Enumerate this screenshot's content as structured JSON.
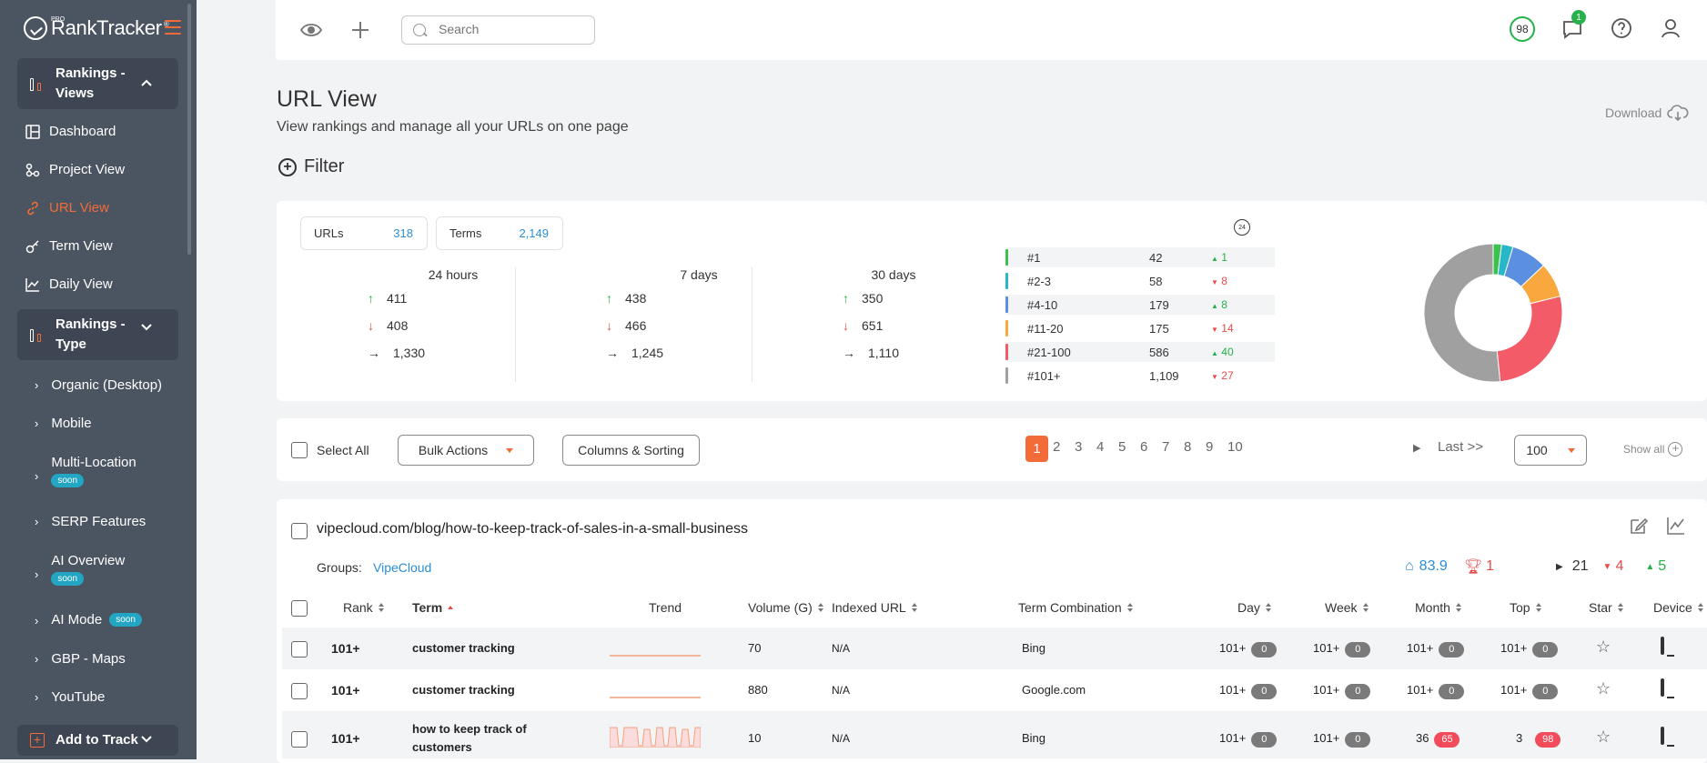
{
  "app": {
    "brand": "RankTracker",
    "pro_label": "PRO",
    "tm": "®"
  },
  "sidebar": {
    "sections": [
      {
        "label_line1": "Rankings -",
        "label_line2": "Views"
      },
      {
        "label_line1": "Rankings -",
        "label_line2": "Type"
      }
    ],
    "views": [
      {
        "label": "Dashboard"
      },
      {
        "label": "Project View"
      },
      {
        "label": "URL View"
      },
      {
        "label": "Term View"
      },
      {
        "label": "Daily View"
      }
    ],
    "types": [
      {
        "label": "Organic (Desktop)",
        "badge": ""
      },
      {
        "label": "Mobile",
        "badge": ""
      },
      {
        "label": "Multi-Location",
        "badge": "soon"
      },
      {
        "label": "SERP Features",
        "badge": ""
      },
      {
        "label": "AI Overview",
        "badge": "soon"
      },
      {
        "label": "AI Mode",
        "badge": "soon"
      },
      {
        "label": "GBP - Maps",
        "badge": ""
      },
      {
        "label": "YouTube",
        "badge": ""
      }
    ],
    "add_to_track": "Add to Track"
  },
  "header": {
    "search_placeholder": "Search",
    "score": "98",
    "notifications": "1"
  },
  "page": {
    "title": "URL View",
    "subtitle": "View rankings and manage all your URLs on one page",
    "download": "Download",
    "filter": "Filter"
  },
  "stats": {
    "urls_label": "URLs",
    "urls_value": "318",
    "terms_label": "Terms",
    "terms_value": "2,149",
    "periods": [
      {
        "label": "24 hours",
        "up": "411",
        "down": "408",
        "same": "1,330"
      },
      {
        "label": "7 days",
        "up": "438",
        "down": "466",
        "same": "1,245"
      },
      {
        "label": "30 days",
        "up": "350",
        "down": "651",
        "same": "1,110"
      }
    ],
    "clock_label": "24",
    "ranks": [
      {
        "label": "#1",
        "value": "42",
        "change": "1",
        "dir": "up",
        "color": "#3cc04e",
        "share": 42
      },
      {
        "label": "#2-3",
        "value": "58",
        "change": "8",
        "dir": "down",
        "color": "#28b7c9",
        "share": 58
      },
      {
        "label": "#4-10",
        "value": "179",
        "change": "8",
        "dir": "up",
        "color": "#5b8fe0",
        "share": 179
      },
      {
        "label": "#11-20",
        "value": "175",
        "change": "14",
        "dir": "down",
        "color": "#f8a83c",
        "share": 175
      },
      {
        "label": "#21-100",
        "value": "586",
        "change": "40",
        "dir": "up",
        "color": "#f45b69",
        "share": 586
      },
      {
        "label": "#101+",
        "value": "1,109",
        "change": "27",
        "dir": "down",
        "color": "#a0a0a0",
        "share": 1109
      }
    ]
  },
  "toolbar": {
    "select_all": "Select All",
    "bulk_actions": "Bulk Actions",
    "columns_sorting": "Columns & Sorting",
    "pages": [
      "1",
      "2",
      "3",
      "4",
      "5",
      "6",
      "7",
      "8",
      "9",
      "10"
    ],
    "last": "Last >>",
    "per_page": "100",
    "show_all": "Show all"
  },
  "url_card": {
    "url": "vipecloud.com/blog/how-to-keep-track-of-sales-in-a-small-business",
    "groups_label": "Groups:",
    "group": "VipeCloud",
    "metric_score": "83.9",
    "metric_trophy": "1",
    "metric_same": "21",
    "metric_down": "4",
    "metric_up": "5",
    "columns": {
      "rank": "Rank",
      "term": "Term",
      "trend": "Trend",
      "volume": "Volume (G)",
      "indexed": "Indexed URL",
      "combo": "Term Combination",
      "day": "Day",
      "week": "Week",
      "month": "Month",
      "top": "Top",
      "star": "Star",
      "device": "Device"
    },
    "rows": [
      {
        "rank": "101+",
        "term": "customer tracking",
        "term2": "",
        "volume": "70",
        "indexed": "N/A",
        "combo": "Bing",
        "day": "101+",
        "day_b": "0",
        "week": "101+",
        "week_b": "0",
        "month": "101+",
        "month_b": "0",
        "top": "101+",
        "top_b": "0"
      },
      {
        "rank": "101+",
        "term": "customer tracking",
        "term2": "",
        "volume": "880",
        "indexed": "N/A",
        "combo": "Google.com",
        "day": "101+",
        "day_b": "0",
        "week": "101+",
        "week_b": "0",
        "month": "101+",
        "month_b": "0",
        "top": "101+",
        "top_b": "0"
      },
      {
        "rank": "101+",
        "term": "how to keep track of",
        "term2": "customers",
        "volume": "10",
        "indexed": "N/A",
        "combo": "Bing",
        "day": "101+",
        "day_b": "0",
        "week": "101+",
        "week_b": "0",
        "month": "36",
        "month_b": "65",
        "top": "3",
        "top_b": "98"
      }
    ]
  },
  "colors": {
    "accent": "#f36b38",
    "link": "#2b8fd6",
    "up": "#27b14a",
    "down": "#e94b4b"
  }
}
